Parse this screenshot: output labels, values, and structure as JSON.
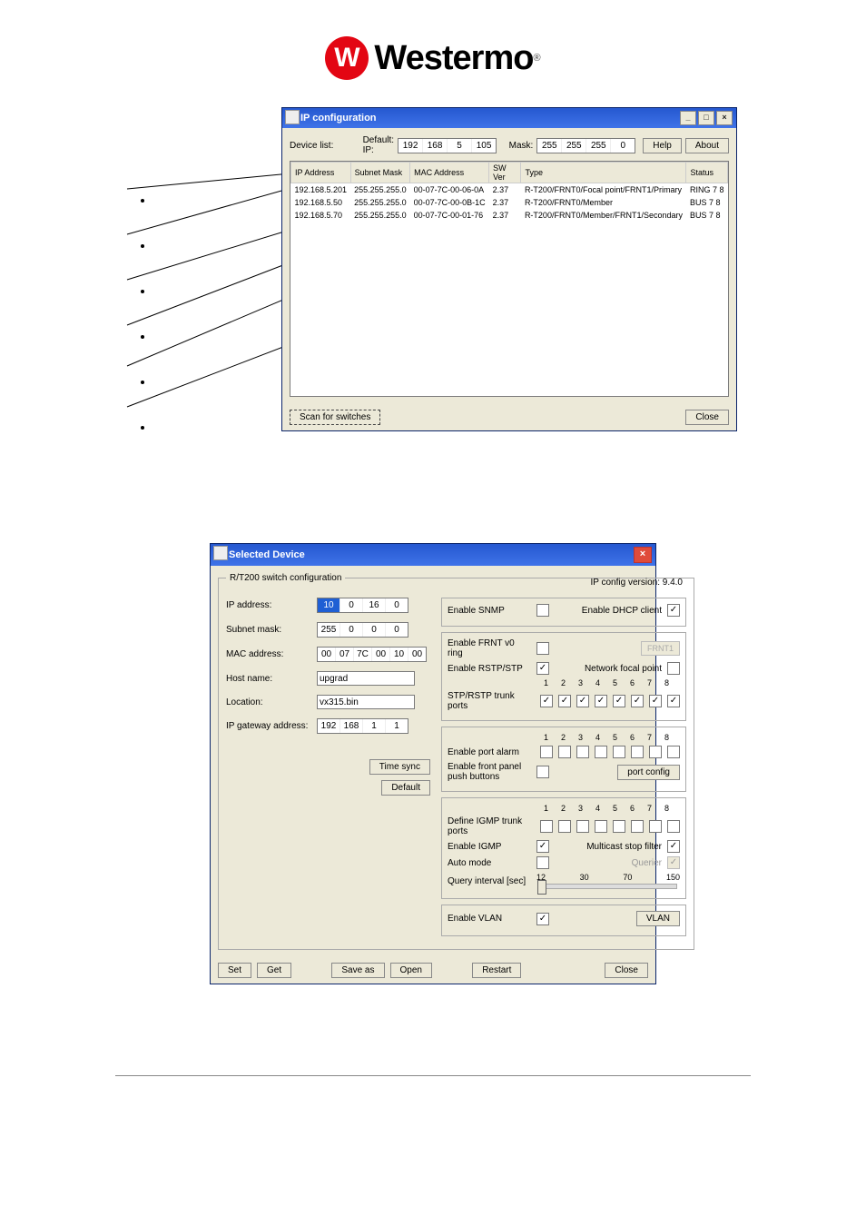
{
  "logo": {
    "mark": "W",
    "text": "Westermo"
  },
  "win1": {
    "title": "IP configuration",
    "device_list_label": "Device list:",
    "default_ip_label": "Default: IP:",
    "default_ip": [
      "192",
      "168",
      "5",
      "105"
    ],
    "mask_label": "Mask:",
    "mask": [
      "255",
      "255",
      "255",
      "0"
    ],
    "help_btn": "Help",
    "about_btn": "About",
    "headers": [
      "IP Address",
      "Subnet Mask",
      "MAC Address",
      "SW Ver",
      "Type",
      "Status"
    ],
    "rows": [
      {
        "ip": "192.168.5.201",
        "mask": "255.255.255.0",
        "mac": "00-07-7C-00-06-0A",
        "sw": "2.37",
        "type": "R-T200/FRNT0/Focal point/FRNT1/Primary",
        "status": "RING  7  8"
      },
      {
        "ip": "192.168.5.50",
        "mask": "255.255.255.0",
        "mac": "00-07-7C-00-0B-1C",
        "sw": "2.37",
        "type": "R-T200/FRNT0/Member",
        "status": "BUS   7  8"
      },
      {
        "ip": "192.168.5.70",
        "mask": "255.255.255.0",
        "mac": "00-07-7C-00-01-76",
        "sw": "2.37",
        "type": "R-T200/FRNT0/Member/FRNT1/Secondary",
        "status": "BUS   7  8"
      }
    ],
    "scan_btn": "Scan for switches",
    "close_btn": "Close"
  },
  "win2": {
    "title": "Selected Device",
    "legend": "R/T200 switch configuration",
    "version": "IP config version: 9.4.0",
    "left": {
      "ip_label": "IP address:",
      "ip": [
        "10",
        "0",
        "16",
        "0"
      ],
      "subnet_label": "Subnet mask:",
      "subnet": [
        "255",
        "0",
        "0",
        "0"
      ],
      "mac_label": "MAC address:",
      "mac": [
        "00",
        "07",
        "7C",
        "00",
        "10",
        "00"
      ],
      "host_label": "Host name:",
      "host": "upgrad",
      "location_label": "Location:",
      "location": "vx315.bin",
      "gateway_label": "IP gateway address:",
      "gateway": [
        "192",
        "168",
        "1",
        "1"
      ],
      "time_sync_btn": "Time sync",
      "default_btn": "Default"
    },
    "right": {
      "snmp": "Enable SNMP",
      "dhcp": "Enable DHCP client",
      "frnt_v0": "Enable FRNT v0 ring",
      "frnt1_btn": "FRNT1",
      "rstp": "Enable RSTP/STP",
      "focal": "Network focal point",
      "stp_trunk": "STP/RSTP trunk ports",
      "port_alarm": "Enable port alarm",
      "front_panel": "Enable front panel push buttons",
      "port_config_btn": "port config",
      "igmp_trunk": "Define IGMP trunk ports",
      "enable_igmp": "Enable IGMP",
      "multicast": "Multicast stop filter",
      "auto_mode": "Auto mode",
      "querier": "Querier",
      "query_interval": "Query interval [sec]",
      "slider_ticks": [
        "12",
        "30",
        "70",
        "150"
      ],
      "enable_vlan": "Enable VLAN",
      "vlan_btn": "VLAN",
      "ports": [
        "1",
        "2",
        "3",
        "4",
        "5",
        "6",
        "7",
        "8"
      ]
    },
    "footer": {
      "set": "Set",
      "get": "Get",
      "save_as": "Save as",
      "open": "Open",
      "restart": "Restart",
      "close": "Close"
    }
  }
}
